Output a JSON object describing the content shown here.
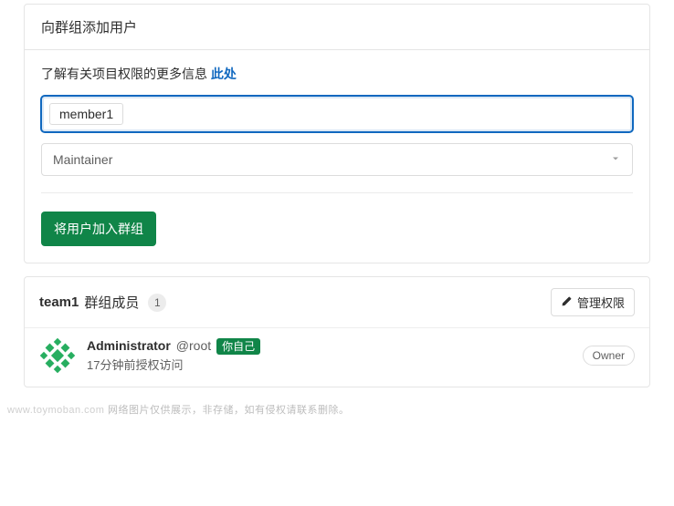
{
  "add_card": {
    "title": "向群组添加用户",
    "info_text": "了解有关项目权限的更多信息",
    "info_link": "此处",
    "selected_member": "member1",
    "role_selected": "Maintainer",
    "submit_label": "将用户加入群组"
  },
  "members": {
    "group_name": "team1",
    "title_suffix": "群组成员",
    "count": "1",
    "manage_label": "管理权限",
    "list": [
      {
        "name": "Administrator",
        "handle": "@root",
        "self_badge": "你自己",
        "granted_text": "17分钟前授权访问",
        "role": "Owner"
      }
    ]
  },
  "footer": {
    "domain": "www.toymoban.com",
    "note": "网络图片仅供展示，非存储，如有侵权请联系删除。"
  }
}
